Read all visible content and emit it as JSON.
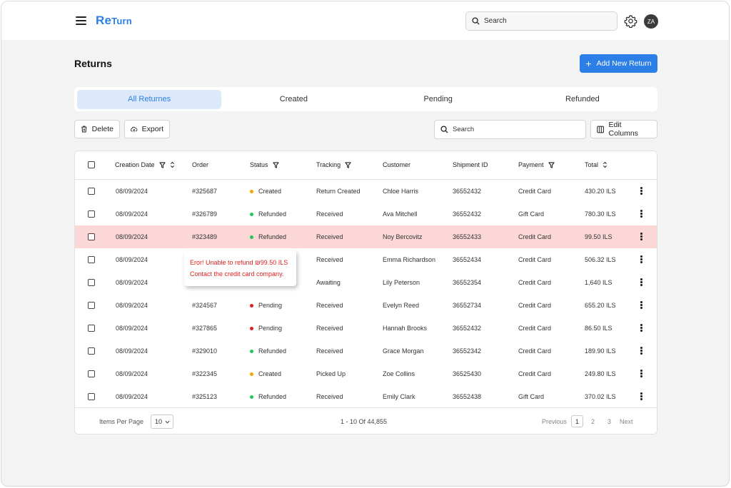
{
  "header": {
    "logo_main": "Re",
    "logo_tail": "Turn",
    "search_placeholder": "Search",
    "avatar_initials": "ZA",
    "brand_color": "#2b7fe6"
  },
  "page": {
    "title": "Returns",
    "add_button": "Add New Return"
  },
  "tabs": [
    {
      "label": "All Returnes",
      "active": true
    },
    {
      "label": "Created",
      "active": false
    },
    {
      "label": "Pending",
      "active": false
    },
    {
      "label": "Refunded",
      "active": false
    }
  ],
  "toolbar": {
    "delete_label": "Delete",
    "export_label": "Export",
    "search_placeholder": "Search",
    "edit_columns_label": "Edit Columns"
  },
  "table": {
    "columns": [
      "Creation Date",
      "Order",
      "Status",
      "Tracking",
      "Customer",
      "Shipment ID",
      "Payment",
      "Total"
    ],
    "status_colors": {
      "Created": "#f0a500",
      "Refunded": "#22c55e",
      "Pending": "#e11d1d"
    },
    "highlight_color": "#fbd7d7",
    "rows": [
      {
        "date": "08/09/2024",
        "order": "#325687",
        "status": "Created",
        "tracking": "Return Created",
        "customer": "Chloe Harris",
        "shipment": "36552432",
        "payment": "Credit Card",
        "total": "430.20 ILS",
        "highlight": false
      },
      {
        "date": "08/09/2024",
        "order": "#326789",
        "status": "Refunded",
        "tracking": "Received",
        "customer": "Ava Mitchell",
        "shipment": "36552432",
        "payment": "Gift Card",
        "total": "780.30 ILS",
        "highlight": false
      },
      {
        "date": "08/09/2024",
        "order": "#323489",
        "status": "Refunded",
        "tracking": "Received",
        "customer": "Noy Bercovitz",
        "shipment": "36552433",
        "payment": "Credit Card",
        "total": "99.50 ILS",
        "highlight": true
      },
      {
        "date": "08/09/2024",
        "order": "",
        "status": "",
        "tracking": "Received",
        "customer": "Emma Richardson",
        "shipment": "36552434",
        "payment": "Credit Card",
        "total": "506.32 ILS",
        "highlight": false
      },
      {
        "date": "08/09/2024",
        "order": "",
        "status": "",
        "tracking": "Awaiting",
        "customer": "Lily Peterson",
        "shipment": "36552354",
        "payment": "Credit Card",
        "total": "1,640 ILS",
        "highlight": false
      },
      {
        "date": "08/09/2024",
        "order": "#324567",
        "status": "Pending",
        "tracking": "Received",
        "customer": "Evelyn Reed",
        "shipment": "36552734",
        "payment": "Credit Card",
        "total": "655.20 ILS",
        "highlight": false
      },
      {
        "date": "08/09/2024",
        "order": "#327865",
        "status": "Pending",
        "tracking": "Received",
        "customer": "Hannah Brooks",
        "shipment": "36552432",
        "payment": "Credit Card",
        "total": "86.50 ILS",
        "highlight": false
      },
      {
        "date": "08/09/2024",
        "order": "#329010",
        "status": "Refunded",
        "tracking": "Received",
        "customer": "Grace Morgan",
        "shipment": "36552342",
        "payment": "Credit Card",
        "total": "189.90 ILS",
        "highlight": false
      },
      {
        "date": "08/09/2024",
        "order": "#322345",
        "status": "Created",
        "tracking": "Picked Up",
        "customer": "Zoe Collins",
        "shipment": "36525430",
        "payment": "Credit Card",
        "total": "249.80 ILS",
        "highlight": false
      },
      {
        "date": "08/09/2024",
        "order": "#325123",
        "status": "Refunded",
        "tracking": "Received",
        "customer": "Emily Clark",
        "shipment": "36552438",
        "payment": "Gift Card",
        "total": "370.02 ILS",
        "highlight": false
      }
    ]
  },
  "error_tooltip": {
    "line1": "Eror! Unable to refund ₪99.50 ILS",
    "line2": "Contact the credit card company."
  },
  "footer": {
    "items_per_page_label": "Items Per Page",
    "items_per_page_value": "10",
    "range_text": "1 - 10 Of 44,855",
    "previous": "Previous",
    "pages": [
      "1",
      "2",
      "3"
    ],
    "current_page": "1",
    "next": "Next"
  }
}
